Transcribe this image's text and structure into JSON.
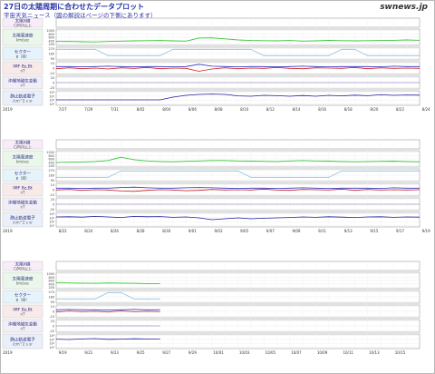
{
  "header": {
    "title": "27日の太陽周期に合わせたデータプロット",
    "subtitle": "宇宙天気ニュース（図の解説はページの下側にあります）"
  },
  "logo": {
    "text": "swnews.jp"
  },
  "colors": {
    "xray_band": "#f7ecf7",
    "wind_band": "#eaf7ea",
    "sector_band": "#e6f3fb",
    "imf_band": "#f9eaea",
    "geo_band": "#f2eef7",
    "electron_band": "#eaf0f9",
    "wind_line": "#38c838",
    "sector_line": "#8fbfe0",
    "imf_bt": "#3030c0",
    "imf_bz": "#d02020",
    "electron_line": "#2020a0"
  },
  "chart_data": {
    "type": "line",
    "year": "2019",
    "panel_labels": [
      {
        "key": "xray",
        "lines": [
          "太陽X線",
          "C/M/X以上"
        ]
      },
      {
        "key": "wind",
        "lines": [
          "太陽風速度",
          "km/sec"
        ]
      },
      {
        "key": "sector",
        "lines": [
          "セクター",
          "φ（度）"
        ]
      },
      {
        "key": "imf",
        "lines": [
          "IMF Bz,Bt",
          "nT"
        ]
      },
      {
        "key": "geo",
        "lines": [
          "沖縄地磁気変動",
          "nT"
        ]
      },
      {
        "key": "electron",
        "lines": [
          "静止軌道電子",
          "/cm^2 s sr"
        ]
      }
    ],
    "axes": {
      "wind": {
        "ticks": [
          "1000",
          "800",
          "600",
          "400",
          "200"
        ],
        "ylim": [
          200,
          1000
        ]
      },
      "sector": {
        "ticks": [
          "270",
          "180",
          "90"
        ],
        "ylim": [
          0,
          360
        ]
      },
      "imf": {
        "ticks": [
          "10",
          "0",
          "-10"
        ],
        "ylim": [
          -20,
          20
        ]
      },
      "geo": {
        "ticks": [
          "20",
          "0",
          "-20"
        ],
        "ylim": [
          -50,
          50
        ]
      },
      "electron": {
        "ticks": [
          "10⁸",
          "10⁶",
          "10⁴",
          "10²"
        ],
        "ylim": [
          1,
          9
        ]
      }
    },
    "rows": [
      {
        "dates": [
          "7/27",
          "7/29",
          "7/31",
          "8/02",
          "8/04",
          "8/06",
          "8/08",
          "8/10",
          "8/12",
          "8/14",
          "8/16",
          "8/18",
          "8/20",
          "8/22",
          "8/24",
          "8/26",
          "8/28",
          "8/30",
          "9/01",
          "9/03"
        ],
        "length": 28,
        "series": {
          "wind": [
            390,
            395,
            380,
            370,
            390,
            410,
            420,
            430,
            440,
            420,
            410,
            560,
            570,
            520,
            470,
            440,
            430,
            420,
            440,
            410,
            420,
            450,
            430,
            420,
            430,
            440,
            450,
            470,
            450
          ],
          "sector": [
            300,
            300,
            300,
            300,
            120,
            120,
            120,
            120,
            120,
            300,
            300,
            300,
            300,
            300,
            300,
            300,
            120,
            120,
            120,
            120,
            120,
            120,
            300,
            300,
            120,
            120,
            120,
            120,
            120
          ],
          "bt": [
            5,
            5,
            4,
            5,
            6,
            5,
            4,
            5,
            5,
            4,
            5,
            12,
            6,
            5,
            4,
            5,
            5,
            4,
            5,
            6,
            5,
            4,
            5,
            5,
            5,
            4,
            6,
            5,
            5
          ],
          "bz": [
            -2,
            1,
            -2,
            0,
            -3,
            1,
            -1,
            2,
            -2,
            0,
            -1,
            -10,
            -3,
            1,
            -2,
            0,
            -1,
            2,
            -1,
            -2,
            1,
            0,
            -1,
            2,
            -2,
            1,
            -1,
            0,
            -1
          ],
          "electron": [
            4,
            4,
            4,
            4,
            4,
            4,
            4,
            4,
            4,
            5.5,
            6.5,
            7,
            7.2,
            7,
            6.2,
            6,
            6.5,
            6.3,
            6,
            6.4,
            6,
            6.5,
            6.2,
            6.6,
            6.3,
            6.8,
            6.5,
            6.7,
            6.6
          ]
        }
      },
      {
        "dates": [
          "8/22",
          "8/24",
          "8/26",
          "8/28",
          "8/30",
          "9/01",
          "9/03",
          "9/05",
          "9/07",
          "9/09",
          "9/11",
          "9/13",
          "9/15",
          "9/17",
          "9/19",
          "9/21",
          "9/23",
          "9/25",
          "9/27",
          "9/29"
        ],
        "length": 28,
        "series": {
          "wind": [
            420,
            440,
            450,
            470,
            520,
            680,
            560,
            500,
            470,
            460,
            480,
            500,
            520,
            520,
            500,
            490,
            480,
            470,
            500,
            520,
            500,
            490,
            470,
            460,
            470,
            480,
            490,
            470,
            460
          ],
          "sector": [
            120,
            120,
            120,
            120,
            120,
            300,
            300,
            300,
            300,
            300,
            300,
            300,
            300,
            300,
            300,
            120,
            120,
            120,
            120,
            120,
            120,
            120,
            300,
            300,
            300,
            300,
            300,
            300,
            300
          ],
          "bt": [
            5,
            5,
            4,
            5,
            5,
            7,
            8,
            6,
            5,
            5,
            6,
            7,
            6,
            5,
            4,
            5,
            5,
            4,
            5,
            6,
            5,
            4,
            5,
            5,
            5,
            4,
            6,
            5,
            5
          ],
          "bz": [
            -1,
            1,
            -2,
            0,
            -1,
            -4,
            -5,
            -2,
            0,
            -1,
            -3,
            -2,
            1,
            -1,
            0,
            -1,
            2,
            -1,
            -2,
            1,
            0,
            -1,
            2,
            -2,
            1,
            -1,
            0,
            -1,
            0
          ],
          "electron": [
            6.5,
            6.6,
            6.4,
            6.8,
            6.5,
            6.2,
            6.8,
            6.6,
            6.7,
            6.3,
            6.5,
            6,
            5,
            5.5,
            6,
            5.5,
            5.8,
            6,
            6.2,
            6.5,
            6.3,
            6.6,
            6.4,
            6.2,
            6.5,
            6.6,
            6.3,
            6.5,
            6.4
          ]
        }
      },
      {
        "dates": [
          "9/19",
          "9/21",
          "9/23",
          "9/25",
          "9/27",
          "9/29",
          "10/01",
          "10/03",
          "10/05",
          "10/07",
          "10/09",
          "10/11",
          "10/13",
          "10/15"
        ],
        "length": 28,
        "partial_days": 8,
        "series": {
          "wind": [
            500,
            480,
            470,
            460,
            480,
            470,
            460,
            450,
            440
          ],
          "sector": [
            120,
            120,
            120,
            120,
            300,
            300,
            120,
            120,
            120
          ],
          "bt": [
            5,
            6,
            5,
            5,
            4,
            5,
            6,
            5,
            5
          ],
          "bz": [
            -2,
            1,
            -1,
            0,
            -2,
            1,
            -1,
            0,
            -1
          ],
          "electron": [
            6.2,
            6,
            6.3,
            6.5,
            6.1,
            6.2,
            6.4,
            6.3,
            6.2
          ]
        }
      }
    ]
  }
}
